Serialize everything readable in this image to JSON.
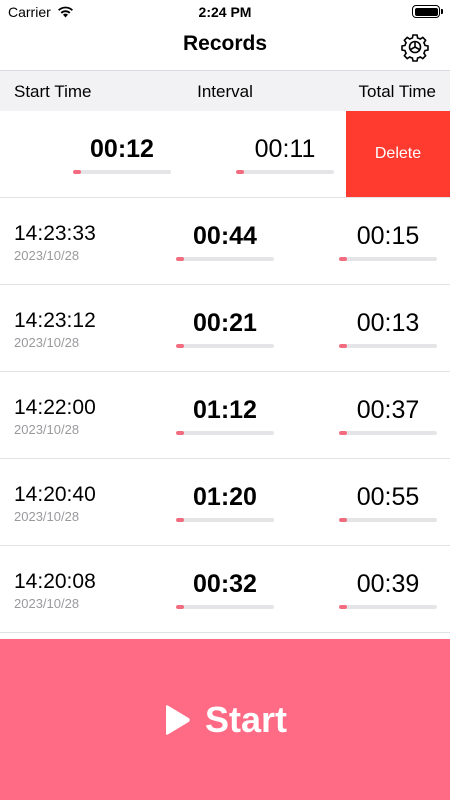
{
  "status_bar": {
    "carrier": "Carrier",
    "time": "2:24 PM"
  },
  "nav": {
    "title": "Records",
    "settings_icon": "gear-icon"
  },
  "columns": {
    "start": "Start Time",
    "interval": "Interval",
    "total": "Total Time"
  },
  "swiped_row": {
    "interval": "00:12",
    "total": "00:11",
    "interval_progress": 0.08,
    "total_progress": 0.08,
    "delete_label": "Delete"
  },
  "rows": [
    {
      "clock": "14:23:33",
      "date": "2023/10/28",
      "interval": "00:44",
      "total": "00:15",
      "interval_progress": 0.08,
      "total_progress": 0.08
    },
    {
      "clock": "14:23:12",
      "date": "2023/10/28",
      "interval": "00:21",
      "total": "00:13",
      "interval_progress": 0.08,
      "total_progress": 0.08
    },
    {
      "clock": "14:22:00",
      "date": "2023/10/28",
      "interval": "01:12",
      "total": "00:37",
      "interval_progress": 0.08,
      "total_progress": 0.08
    },
    {
      "clock": "14:20:40",
      "date": "2023/10/28",
      "interval": "01:20",
      "total": "00:55",
      "interval_progress": 0.08,
      "total_progress": 0.08
    },
    {
      "clock": "14:20:08",
      "date": "2023/10/28",
      "interval": "00:32",
      "total": "00:39",
      "interval_progress": 0.08,
      "total_progress": 0.08
    }
  ],
  "start_button": {
    "label": "Start",
    "icon": "play-icon"
  },
  "colors": {
    "accent": "#ff6b85",
    "progress": "#f26b7e",
    "delete": "#ff3b30",
    "header_bg": "#f2f2f4"
  }
}
